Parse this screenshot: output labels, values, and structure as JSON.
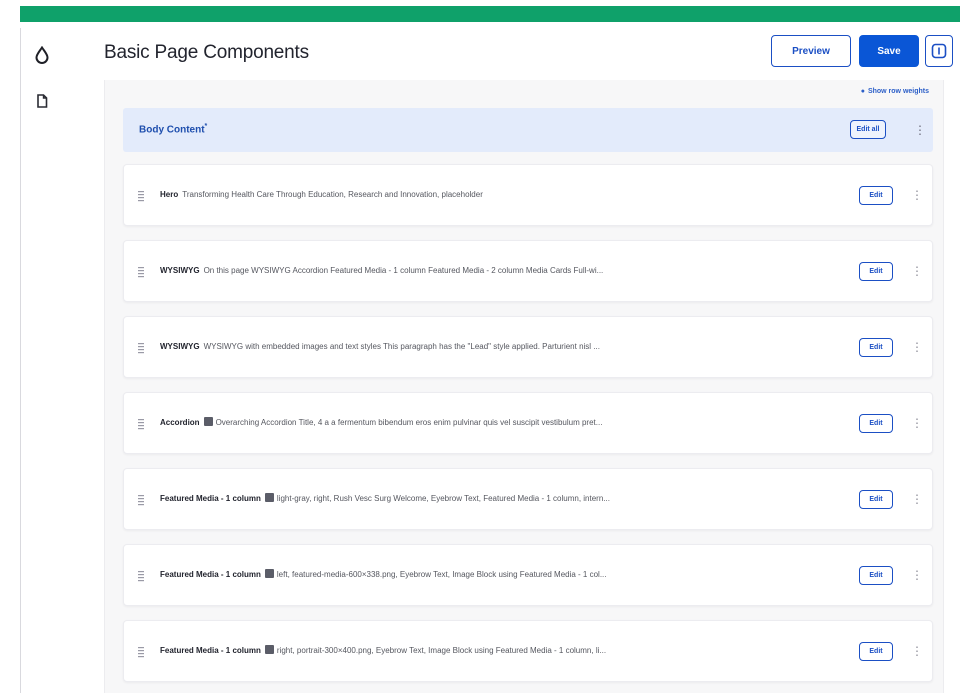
{
  "header": {
    "title": "Basic Page Components",
    "preview_label": "Preview",
    "save_label": "Save"
  },
  "toolbar": {
    "show_row_weights": "Show row weights"
  },
  "section": {
    "title": "Body Content",
    "required_mark": "*",
    "edit_all_label": "Edit all"
  },
  "cards": [
    {
      "type": "Hero",
      "has_icon": false,
      "summary": "Transforming Health Care Through Education, Research and Innovation, placeholder",
      "edit_label": "Edit"
    },
    {
      "type": "WYSIWYG",
      "has_icon": false,
      "summary": "On this page WYSIWYG Accordion Featured Media - 1 column Featured Media - 2 column Media Cards Full-wi...",
      "edit_label": "Edit"
    },
    {
      "type": "WYSIWYG",
      "has_icon": false,
      "summary": "WYSIWYG with embedded images and text styles This paragraph has the \"Lead\" style applied. Parturient nisl ...",
      "edit_label": "Edit"
    },
    {
      "type": "Accordion",
      "has_icon": true,
      "summary": "Overarching Accordion Title, 4 a a fermentum bibendum eros enim pulvinar quis vel suscipit vestibulum pret...",
      "edit_label": "Edit"
    },
    {
      "type": "Featured Media - 1 column",
      "has_icon": true,
      "summary": "light-gray, right, Rush Vesc Surg Welcome, Eyebrow Text, Featured Media - 1 column, intern...",
      "edit_label": "Edit"
    },
    {
      "type": "Featured Media - 1 column",
      "has_icon": true,
      "summary": "left, featured-media-600×338.png, Eyebrow Text, Image Block using Featured Media - 1 col...",
      "edit_label": "Edit"
    },
    {
      "type": "Featured Media - 1 column",
      "has_icon": true,
      "summary": "right, portrait-300×400.png, Eyebrow Text, Image Block using Featured Media - 1 column, li...",
      "edit_label": "Edit"
    }
  ],
  "colors": {
    "brand_green": "#0fa16a",
    "primary_blue": "#0a56d6",
    "section_bg": "#e3ebfb"
  },
  "icons": {
    "rail_top": "drop-icon",
    "rail_second": "document-icon",
    "panel_toggle": "sidebar-panel-icon",
    "drag": "drag-handle-icon",
    "more": "kebab-menu-icon"
  }
}
